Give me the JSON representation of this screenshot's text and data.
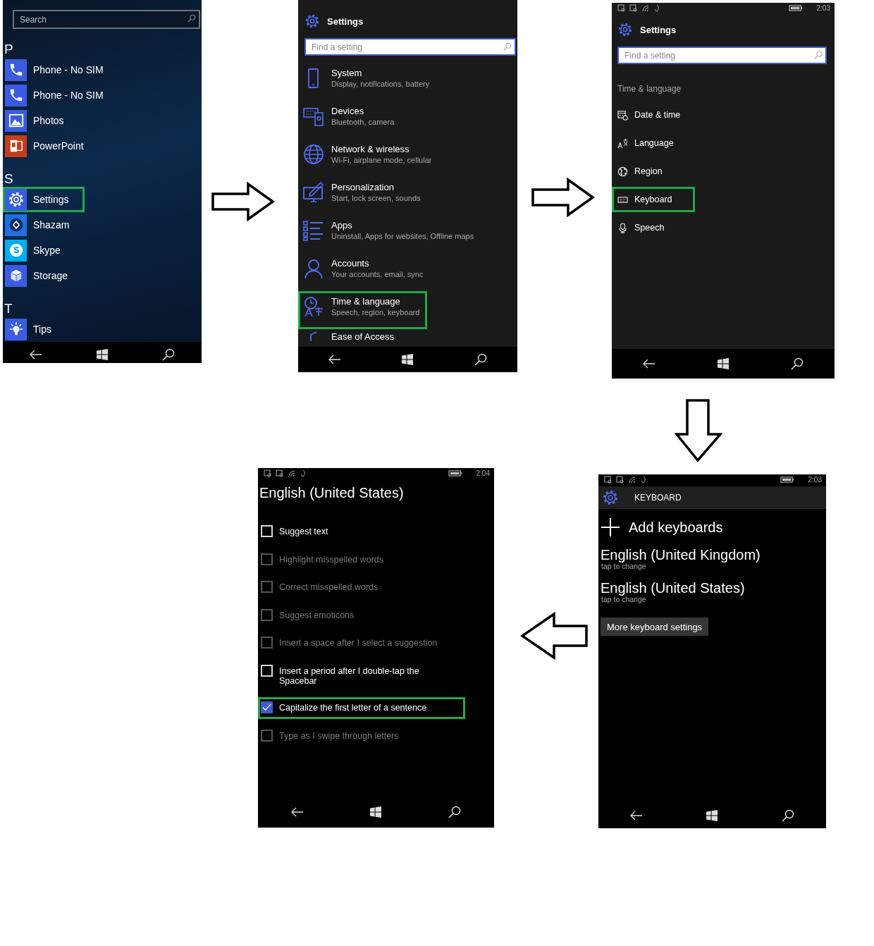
{
  "start_screen": {
    "search": {
      "placeholder": "Search"
    },
    "groups": [
      {
        "letter": "P",
        "apps": [
          {
            "kind": "phone",
            "label": "Phone - No SIM",
            "color": "#3b5ce0",
            "highlighted": false
          },
          {
            "kind": "phone",
            "label": "Phone - No SIM",
            "color": "#3b5ce0",
            "highlighted": false
          },
          {
            "kind": "photos",
            "label": "Photos",
            "color": "#3b5ce0",
            "highlighted": false
          },
          {
            "kind": "powerpoint",
            "label": "PowerPoint",
            "color": "#c43e1c",
            "highlighted": false
          }
        ]
      },
      {
        "letter": "S",
        "apps": [
          {
            "kind": "settings",
            "label": "Settings",
            "color": "#3b5ce0",
            "highlighted": true
          },
          {
            "kind": "shazam",
            "label": "Shazam",
            "color": "#1e6fe0",
            "highlighted": false
          },
          {
            "kind": "skype",
            "label": "Skype",
            "color": "#00aff0",
            "highlighted": false
          },
          {
            "kind": "storage",
            "label": "Storage",
            "color": "#3b5ce0",
            "highlighted": false
          }
        ]
      },
      {
        "letter": "T",
        "apps": [
          {
            "kind": "tips",
            "label": "Tips",
            "color": "#3b5ce0",
            "highlighted": false
          }
        ]
      }
    ]
  },
  "settings_screen": {
    "title": "Settings",
    "search": {
      "placeholder": "Find a setting"
    },
    "categories": [
      {
        "kind": "system",
        "title": "System",
        "subtitle": "Display, notifications, battery",
        "highlighted": false
      },
      {
        "kind": "devices",
        "title": "Devices",
        "subtitle": "Bluetooth, camera",
        "highlighted": false
      },
      {
        "kind": "network",
        "title": "Network & wireless",
        "subtitle": "Wi-Fi, airplane mode, cellular",
        "highlighted": false
      },
      {
        "kind": "personalization",
        "title": "Personalization",
        "subtitle": "Start, lock screen, sounds",
        "highlighted": false
      },
      {
        "kind": "apps",
        "title": "Apps",
        "subtitle": "Uninstall, Apps for websites, Offline maps",
        "highlighted": false
      },
      {
        "kind": "accounts",
        "title": "Accounts",
        "subtitle": "Your accounts, email, sync",
        "highlighted": false
      },
      {
        "kind": "time",
        "title": "Time & language",
        "subtitle": "Speech, region, keyboard",
        "highlighted": true
      },
      {
        "kind": "ease",
        "title": "Ease of Access",
        "highlighted": false
      }
    ]
  },
  "time_language_screen": {
    "time": "2:03",
    "title": "Settings",
    "search": {
      "placeholder": "Find a setting"
    },
    "section": "Time & language",
    "items": [
      {
        "kind": "date",
        "label": "Date & time",
        "highlighted": false
      },
      {
        "kind": "language",
        "label": "Language",
        "highlighted": false
      },
      {
        "kind": "region",
        "label": "Region",
        "highlighted": false
      },
      {
        "kind": "keyboard",
        "label": "Keyboard",
        "highlighted": true
      },
      {
        "kind": "speech",
        "label": "Speech",
        "highlighted": false
      }
    ]
  },
  "keyboard_screen": {
    "time": "2:03",
    "title": "KEYBOARD",
    "add_label": "Add keyboards",
    "keyboards": [
      {
        "name": "English (United Kingdom)",
        "hint": "tap to change"
      },
      {
        "name": "English (United States)",
        "hint": "tap to change"
      }
    ],
    "more_button": "More keyboard settings"
  },
  "english_screen": {
    "time": "2:04",
    "title": "English (United States)",
    "options": [
      {
        "label": "Suggest text",
        "checked": false,
        "disabled": false,
        "highlighted": false
      },
      {
        "label": "Highlight misspelled words",
        "checked": false,
        "disabled": true,
        "highlighted": false
      },
      {
        "label": "Correct misspelled words",
        "checked": false,
        "disabled": true,
        "highlighted": false
      },
      {
        "label": "Suggest emoticons",
        "checked": false,
        "disabled": true,
        "highlighted": false
      },
      {
        "label": "Insert a space after I select a suggestion",
        "checked": false,
        "disabled": true,
        "highlighted": false
      },
      {
        "label": "Insert a period after I double-tap the Spacebar",
        "checked": false,
        "disabled": false,
        "highlighted": false
      },
      {
        "label": "Capitalize the first letter of a sentence",
        "checked": true,
        "disabled": false,
        "highlighted": true
      },
      {
        "label": "Type as I swipe through letters",
        "checked": false,
        "disabled": true,
        "highlighted": false
      }
    ]
  },
  "arrows": [
    {
      "kind": "right"
    },
    {
      "kind": "right"
    },
    {
      "kind": "down"
    },
    {
      "kind": "left"
    }
  ]
}
